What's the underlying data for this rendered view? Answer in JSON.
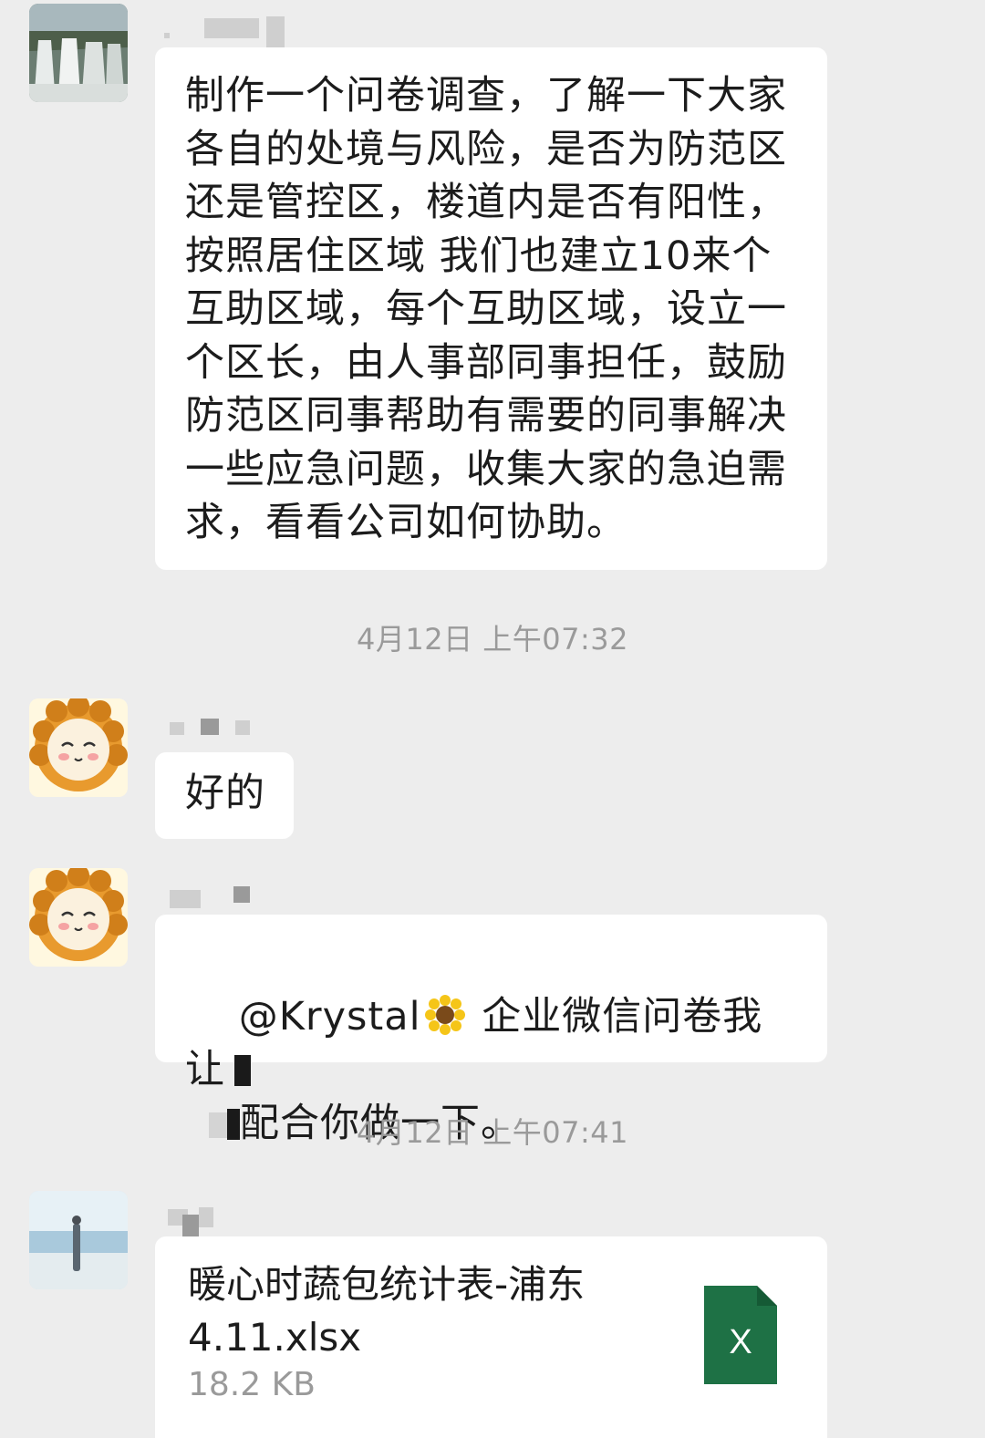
{
  "messages": [
    {
      "text": "制作一个问卷调查，了解一下大家各自的处境与风险，是否为防范区还是管控区，楼道内是否有阳性，按照居住区域 我们也建立10来个互助区域，每个互助区域，设立一个区长，由人事部同事担任，鼓励防范区同事帮助有需要的同事解决一些应急问题，收集大家的急迫需求，看看公司如何协助。",
      "avatar": "waterfall-avatar"
    },
    {
      "text": "好的",
      "avatar": "lion-avatar"
    },
    {
      "mention": "@Krystal",
      "line1_rest": " 企业微信问卷我让",
      "line2": "配合你做一下。",
      "avatar": "lion-avatar"
    },
    {
      "file_name": "暖心时蔬包统计表-浦东4.11.xlsx",
      "file_size": "18.2 KB",
      "file_icon_letter": "X",
      "avatar": "beach-avatar"
    }
  ],
  "timestamps": [
    "4月12日 上午07:32",
    "4月12日 上午07:41"
  ],
  "colors": {
    "background": "#ededed",
    "bubble": "#ffffff",
    "timestamp": "#9a9a9a",
    "excel_green": "#1e7145"
  }
}
